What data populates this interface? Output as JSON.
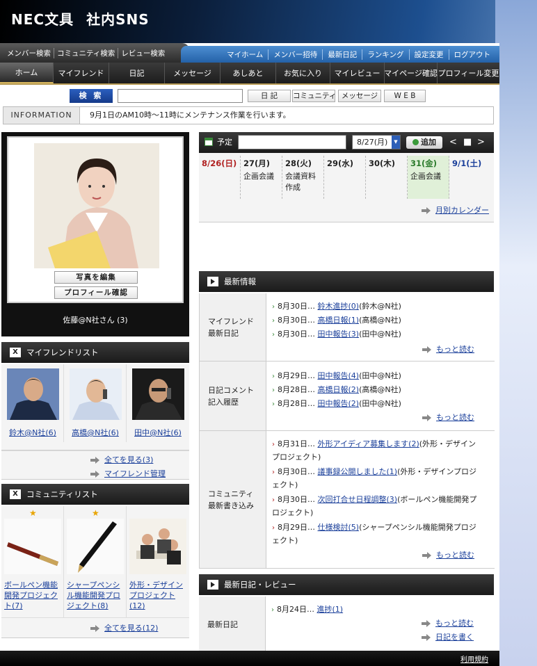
{
  "brand": {
    "logo_left": "NEC文具",
    "logo_right": "社内SNS"
  },
  "nav_top_left": [
    "メンバー検索",
    "コミュニティ検索",
    "レビュー検索"
  ],
  "nav_top_right": [
    "マイホーム",
    "メンバー招待",
    "最新日記",
    "ランキング",
    "設定変更",
    "ログアウト"
  ],
  "nav_main": [
    "ホーム",
    "マイフレンド",
    "日記",
    "メッセージ",
    "あしあと",
    "お気に入り",
    "マイレビュー",
    "マイページ確認",
    "プロフィール変更"
  ],
  "search": {
    "button": "検 索",
    "value": "",
    "tabs": [
      "日 記",
      "コミュニティ",
      "メッセージ",
      "W E B"
    ]
  },
  "information": {
    "label": "INFORMATION",
    "text": "9月1日のAM10時〜11時にメンテナンス作業を行います。"
  },
  "profile": {
    "edit_photo": "写真を編集",
    "check_profile": "プロフィール確認",
    "name": "佐藤@N社さん (3)"
  },
  "friends": {
    "title": "マイフレンドリスト",
    "items": [
      "鈴木@N社(6)",
      "高橋@N社(6)",
      "田中@N社(6)"
    ],
    "see_all": "全てを見る(3)",
    "manage": "マイフレンド管理"
  },
  "communities": {
    "title": "コミュニティリスト",
    "items": [
      "ボールペン機能開発プロジェクト(7)",
      "シャープペンシル機能開発プロジェクト(8)",
      "外形・デザインプロジェクト(12)"
    ],
    "see_all": "全てを見る(12)"
  },
  "schedule": {
    "label": "予定",
    "input_value": "",
    "date_select": "8/27(月)",
    "add_button": "追加",
    "nav": [
      "<",
      "■",
      ">"
    ],
    "days": [
      {
        "date": "8/26(日)",
        "note": "",
        "color": "#b02020"
      },
      {
        "date": "27(月)",
        "note": "企画会議",
        "color": "#222222"
      },
      {
        "date": "28(火)",
        "note": "会議資料作成",
        "color": "#222222"
      },
      {
        "date": "29(水)",
        "note": "",
        "color": "#222222"
      },
      {
        "date": "30(木)",
        "note": "",
        "color": "#222222"
      },
      {
        "date": "31(金)",
        "note": "企画会議",
        "color": "#2a7a2a"
      },
      {
        "date": "9/1(土)",
        "note": "",
        "color": "#1a3f9a"
      }
    ],
    "monthly_link": "月別カレンダー"
  },
  "news": {
    "title": "最新情報",
    "sections": [
      {
        "label": "マイフレンド\n最新日記",
        "items": [
          {
            "date": "8月30日…",
            "link": "鈴木進捗(0)",
            "rest": "(鈴木@N社)"
          },
          {
            "date": "8月30日…",
            "link": "高橋日報(1)",
            "rest": "(高橋@N社)"
          },
          {
            "date": "8月30日…",
            "link": "田中報告(3)",
            "rest": "(田中@N社)"
          }
        ],
        "more": "もっと読む"
      },
      {
        "label": "日記コメント\n記入履歴",
        "items": [
          {
            "date": "8月29日…",
            "link": "田中報告(4)",
            "rest": "(田中@N社)"
          },
          {
            "date": "8月28日…",
            "link": "高橋日報(2)",
            "rest": "(高橋@N社)"
          },
          {
            "date": "8月28日…",
            "link": "田中報告(2)",
            "rest": "(田中@N社)"
          }
        ],
        "more": "もっと読む"
      },
      {
        "label": "コミュニティ\n最新書き込み",
        "items": [
          {
            "date": "8月31日…",
            "link": "外形アイディア募集します(2)",
            "rest": "(外形・デザインプロジェクト)"
          },
          {
            "date": "8月30日…",
            "link": "議事録公開しました(1)",
            "rest": "(外形・デザインプロジェクト)"
          },
          {
            "date": "8月30日…",
            "link": "次回打合せ日程調整(3)",
            "rest": "(ボールペン機能開発プロジェクト)"
          },
          {
            "date": "8月29日…",
            "link": "仕様検討(5)",
            "rest": "(シャープペンシル機能開発プロジェクト)"
          }
        ],
        "more": "もっと読む"
      }
    ]
  },
  "diary": {
    "title": "最新日記・レビュー",
    "label": "最新日記",
    "item": {
      "date": "8月24日…",
      "link": "進捗(1)"
    },
    "more": "もっと読む",
    "write": "日記を書く"
  },
  "footer": {
    "terms": "利用規約"
  }
}
